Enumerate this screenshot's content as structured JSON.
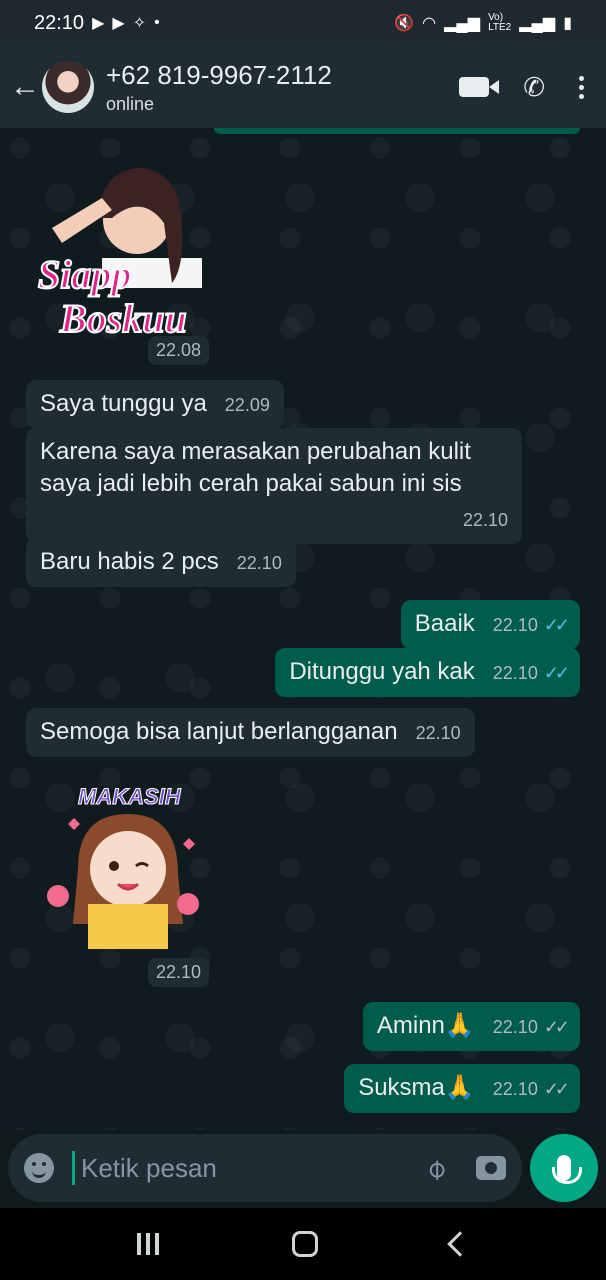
{
  "status_bar": {
    "time": "22:10",
    "icons": [
      "youtube-icon",
      "youtube-icon",
      "magic-icon",
      "dot-icon"
    ],
    "right_icons": [
      "mute-icon",
      "wifi-icon",
      "signal-icon",
      "volte-icon",
      "battery-icon"
    ],
    "lte_label": "Vo)\nLTE2"
  },
  "header": {
    "contact_name": "+62 819-9967-2112",
    "contact_status": "online"
  },
  "stickers": {
    "siapp": {
      "line1": "Siapp",
      "line2": "Boskuu",
      "time": "22.08"
    },
    "makasih": {
      "label": "MAKASIH",
      "time": "22.10"
    }
  },
  "messages": [
    {
      "text": "Saya tunggu ya",
      "time": "22.09",
      "direction": "in"
    },
    {
      "text": "Karena saya merasakan perubahan kulit saya jadi lebih cerah pakai sabun ini sis",
      "time": "22.10",
      "direction": "in"
    },
    {
      "text": "Baru habis 2 pcs",
      "time": "22.10",
      "direction": "in"
    },
    {
      "text": "Baaik",
      "time": "22.10",
      "direction": "out",
      "ticks": "✓✓"
    },
    {
      "text": "Ditunggu yah kak",
      "time": "22.10",
      "direction": "out",
      "ticks": "✓✓"
    },
    {
      "text": "Semoga bisa lanjut berlangganan",
      "time": "22.10",
      "direction": "in"
    },
    {
      "text": "Aminn🙏",
      "time": "22.10",
      "direction": "out",
      "ticks": "✓✓"
    },
    {
      "text": "Suksma🙏",
      "time": "22.10",
      "direction": "out",
      "ticks": "✓✓"
    }
  ],
  "composer": {
    "placeholder": "Ketik pesan"
  },
  "colors": {
    "incoming_bubble": "#1f2c33",
    "outgoing_bubble": "#005c4b",
    "accent": "#00a884",
    "read_tick": "#53bdeb"
  }
}
